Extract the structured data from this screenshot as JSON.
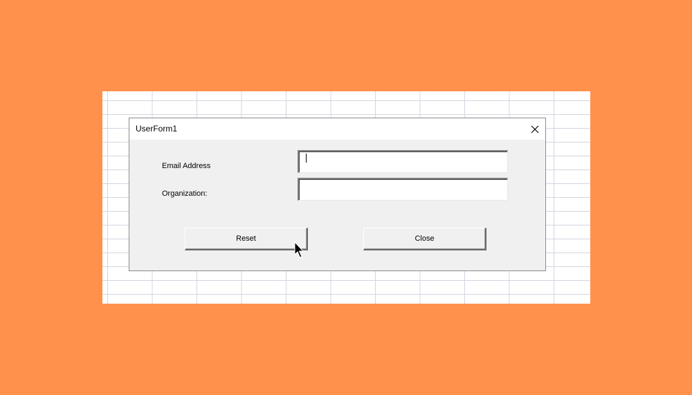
{
  "dialog": {
    "title": "UserForm1",
    "close_icon": "close-icon"
  },
  "form": {
    "email_label": "Email Address",
    "email_value": "",
    "organization_label": "Organization:",
    "organization_value": ""
  },
  "buttons": {
    "reset_label": "Reset",
    "close_label": "Close"
  },
  "colors": {
    "background": "#ff914d",
    "dialog": "#f0f0f0",
    "grid_line": "#d4d4e0"
  }
}
